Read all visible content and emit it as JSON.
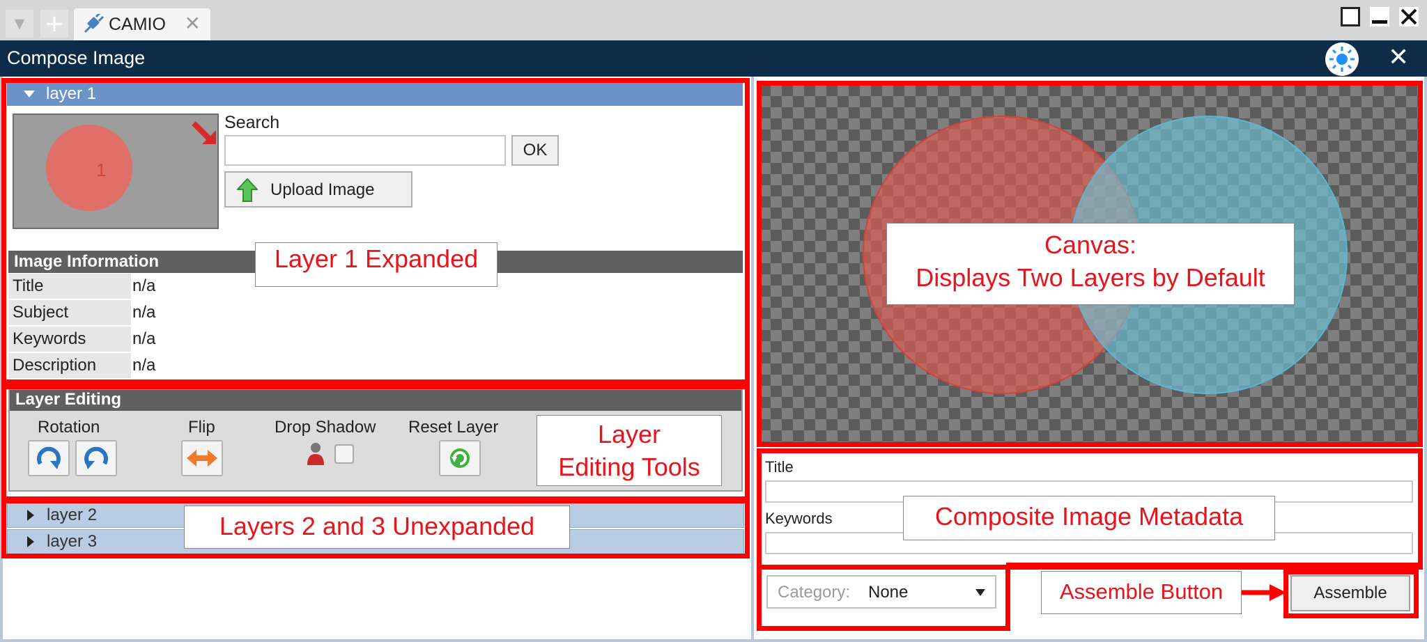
{
  "tabstrip": {
    "tab_label": "CAMIO",
    "tab_close": "✕",
    "add_tab": "+",
    "menu_arrow": "▾"
  },
  "window": {
    "title": "Compose Image",
    "close": "✕"
  },
  "layers": [
    {
      "label": "layer 1",
      "expanded": true
    },
    {
      "label": "layer 2",
      "expanded": false
    },
    {
      "label": "layer 3",
      "expanded": false
    }
  ],
  "layer1": {
    "thumb_number": "1",
    "search_label": "Search",
    "search_value": "",
    "ok_label": "OK",
    "upload_label": "Upload Image",
    "info": {
      "header": "Image Information",
      "rows": [
        {
          "key": "Title",
          "value": "n/a"
        },
        {
          "key": "Subject",
          "value": "n/a"
        },
        {
          "key": "Keywords",
          "value": "n/a"
        },
        {
          "key": "Description",
          "value": "n/a"
        }
      ]
    },
    "editing": {
      "header": "Layer Editing",
      "rotation": "Rotation",
      "flip": "Flip",
      "drop_shadow": "Drop Shadow",
      "reset": "Reset Layer"
    }
  },
  "metadata": {
    "title_label": "Title",
    "title_value": "",
    "keywords_label": "Keywords",
    "keywords_value": "",
    "category_label": "Category:",
    "category_value": "None",
    "assemble_label": "Assemble"
  },
  "annotations": {
    "layer1": "Layer 1 Expanded",
    "canvas_line1": "Canvas:",
    "canvas_line2": "Displays Two Layers by Default",
    "tools_line1": "Layer",
    "tools_line2": "Editing Tools",
    "unexpanded": "Layers 2 and 3  Unexpanded",
    "metadata": "Composite Image Metadata",
    "assemble": "Assemble Button"
  },
  "colors": {
    "titlebar": "#0e2c47",
    "layer_expanded": "#6b93c8",
    "layer_collapsed": "#b8cce4",
    "annotation_red": "#ff0000",
    "layer1_circle": "#e76a63",
    "layer2_circle": "#6cc6dc"
  }
}
